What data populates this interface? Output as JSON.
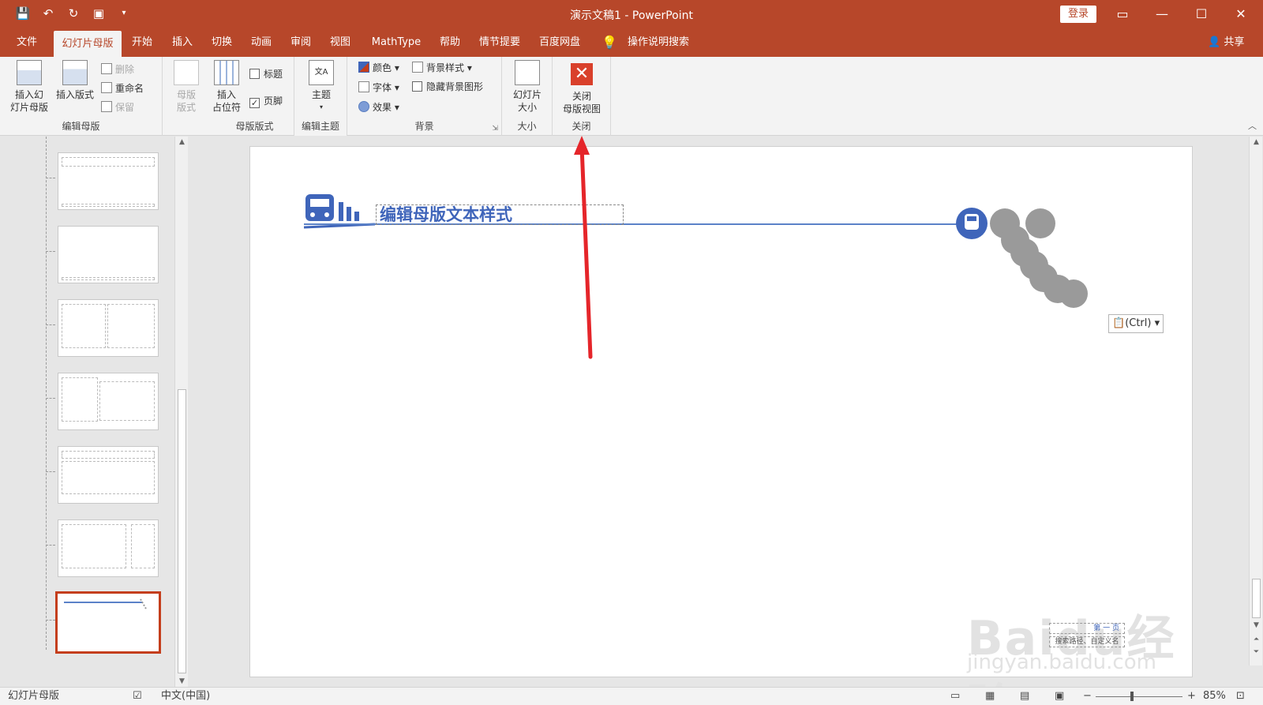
{
  "window": {
    "title": "演示文稿1 - PowerPoint",
    "login_label": "登录",
    "controls": [
      "▭",
      "—",
      "☐",
      "✕"
    ]
  },
  "qat": [
    "💾",
    "↶",
    "↻",
    "▣",
    "▾"
  ],
  "menu": {
    "tabs": [
      "文件",
      "幻灯片母版",
      "开始",
      "插入",
      "切换",
      "动画",
      "审阅",
      "视图",
      "MathType",
      "帮助",
      "情节提要",
      "百度网盘"
    ],
    "active_tab": "幻灯片母版",
    "search_label": "操作说明搜索",
    "share_label": "共享"
  },
  "ribbon": {
    "edit_master": {
      "label": "编辑母版",
      "insert_master": "插入幻\n灯片母版",
      "insert_layout": "插入版式",
      "delete": "删除",
      "rename": "重命名",
      "preserve": "保留"
    },
    "master_layout": {
      "label": "母版版式",
      "master_layout_btn": "母版\n版式",
      "insert_placeholder": "插入\n占位符",
      "title_check": "标题",
      "title_checked": false,
      "footer_check": "页脚",
      "footer_checked": true
    },
    "edit_theme": {
      "label": "编辑主题",
      "themes": "主题"
    },
    "background": {
      "label": "背景",
      "colors": "颜色",
      "fonts": "字体",
      "effects": "效果",
      "bg_styles": "背景样式",
      "hide_bg": "隐藏背景图形"
    },
    "size": {
      "label": "大小",
      "slide_size": "幻灯片\n大小"
    },
    "close": {
      "label": "关闭",
      "close_master": "关闭\n母版视图"
    }
  },
  "slide": {
    "title_placeholder": "编辑母版文本样式",
    "paste_options": "(Ctrl)",
    "footer_text": "第 一 页",
    "footer_text2": "搜索路径、自定义名",
    "watermark_main": "Baidu经验",
    "watermark_sub": "jingyan.baidu.com"
  },
  "statusbar": {
    "view_name": "幻灯片母版",
    "language": "中文(中国)",
    "zoom": "85%"
  },
  "colors": {
    "accent": "#b7472a",
    "title_blue": "#3f65ba",
    "arrow_red": "#e5252a"
  }
}
